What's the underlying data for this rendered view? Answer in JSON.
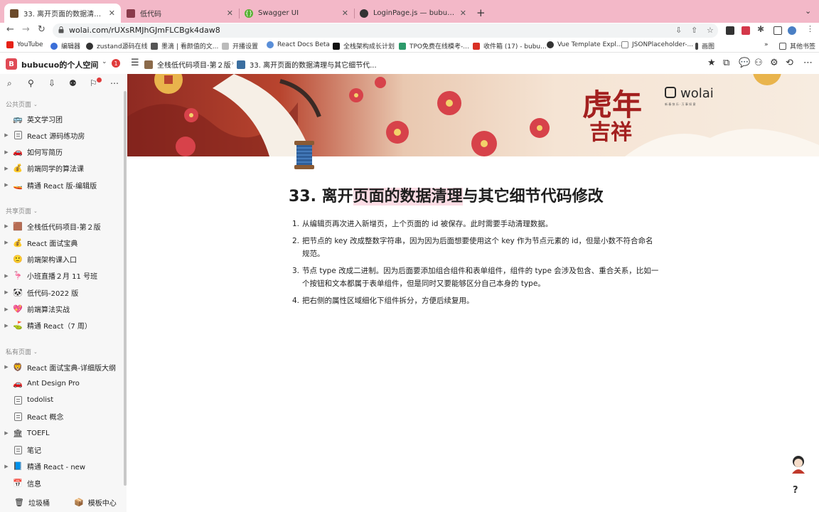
{
  "browser": {
    "tabs": [
      {
        "title": "33. 离开页面的数据清理与其它细节代码修改",
        "active": true
      },
      {
        "title": "低代码",
        "active": false
      },
      {
        "title": "Swagger UI",
        "active": false
      },
      {
        "title": "LoginPage.js — bubucuo/async",
        "active": false
      }
    ],
    "url": "wolai.com/rUXsRMJhGJmFLCBgk4daw8",
    "bookmarks": [
      {
        "label": "YouTube",
        "color": "#e62117"
      },
      {
        "label": "编辑器",
        "color": "#3b6fd8"
      },
      {
        "label": "zustand源码在线",
        "color": "#333333"
      },
      {
        "label": "墨滴 | 看颜值的文...",
        "color": "#555555"
      },
      {
        "label": "开播设置",
        "color": "#aaaaaa"
      },
      {
        "label": "React Docs Beta",
        "color": "#5a8fd8"
      },
      {
        "label": "全栈架构成长计划",
        "color": "#111111"
      },
      {
        "label": "TPO免费在线模考-...",
        "color": "#2c9a6a"
      },
      {
        "label": "收件箱 (17) - bubu...",
        "color": "#d93025"
      },
      {
        "label": "Vue Template Expl...",
        "color": "#333333"
      },
      {
        "label": "JSONPlaceholder-...",
        "color": "#888888"
      },
      {
        "label": "画图",
        "color": "#444444"
      }
    ],
    "bookmarks_other": "其他书签"
  },
  "workspace": {
    "logo_letter": "B",
    "name": "bubucuo的个人空间",
    "badge": "1"
  },
  "breadcrumb": {
    "parent": "全栈低代码项目-第２版",
    "current": "33. 离开页面的数据清理与其它细节代..."
  },
  "sidebar": {
    "sections": {
      "public": "公共页面",
      "shared": "共享页面",
      "private": "私有页面"
    },
    "public_items": [
      {
        "label": "英文学习团",
        "icon": "bus-icon",
        "glyph": "🚌",
        "arrow": false
      },
      {
        "label": "React 源码练功房",
        "icon": "page-icon",
        "glyph": "",
        "arrow": true
      },
      {
        "label": "如何写简历",
        "icon": "car-icon",
        "glyph": "🚗",
        "arrow": true
      },
      {
        "label": "前端同学的算法课",
        "icon": "coin-icon",
        "glyph": "💰",
        "arrow": true
      },
      {
        "label": "精通 React 版-编辑版",
        "icon": "boat-icon",
        "glyph": "🚤",
        "arrow": true
      }
    ],
    "shared_items": [
      {
        "label": "全栈低代码项目-第２版",
        "icon": "box-icon",
        "glyph": "🟫",
        "arrow": true
      },
      {
        "label": "React 面试宝典",
        "icon": "coin-icon",
        "glyph": "💰",
        "arrow": true
      },
      {
        "label": "前端架构课入口",
        "icon": "smile-icon",
        "glyph": "🙂",
        "arrow": false
      },
      {
        "label": "小班直播２月 11 号班",
        "icon": "flamingo-icon",
        "glyph": "🦩",
        "arrow": true
      },
      {
        "label": "低代码-2022 版",
        "icon": "panda-icon",
        "glyph": "🐼",
        "arrow": true
      },
      {
        "label": "前端算法实战",
        "icon": "heart-icon",
        "glyph": "💖",
        "arrow": true
      },
      {
        "label": "精通 React（7 周）",
        "icon": "golf-icon",
        "glyph": "⛳",
        "arrow": true
      }
    ],
    "private_items": [
      {
        "label": "React 面试宝典-详细版大纲",
        "icon": "lion-icon",
        "glyph": "🦁",
        "arrow": true
      },
      {
        "label": "Ant Design Pro",
        "icon": "car-icon",
        "glyph": "🚗",
        "arrow": false
      },
      {
        "label": "todolist",
        "icon": "page-icon",
        "glyph": "",
        "arrow": false
      },
      {
        "label": "React 概念",
        "icon": "page-icon",
        "glyph": "",
        "arrow": false
      },
      {
        "label": "TOEFL",
        "icon": "building-icon",
        "glyph": "🏛",
        "arrow": true
      },
      {
        "label": "笔记",
        "icon": "page-icon",
        "glyph": "",
        "arrow": false
      },
      {
        "label": "精通 React - new",
        "icon": "book-icon",
        "glyph": "📘",
        "arrow": true
      },
      {
        "label": "信息",
        "icon": "calendar-icon",
        "glyph": "📅",
        "arrow": false
      }
    ],
    "trash": "垃圾桶",
    "templates": "模板中心"
  },
  "page": {
    "title_prefix": "33. 离开",
    "title_highlight": "页面的数据清理",
    "title_suffix": "与其它细节代码修改",
    "items": [
      {
        "num": "1.",
        "text": "从编辑页再次进入新增页，上个页面的 id 被保存。此时需要手动清理数据。"
      },
      {
        "num": "2.",
        "text": "把节点的 key 改成整数字符串，因为因为后面想要使用这个 key 作为节点元素的 id，但是小数不符合命名规范。"
      },
      {
        "num": "3.",
        "text": "节点 type 改成二进制。因为后面要添加组合组件和表单组件，组件的 type 会涉及包含、重合关系，比如一个按钮和文本都属于表单组件，但是同时又要能够区分自己本身的 type。"
      },
      {
        "num": "4.",
        "text": "把右侧的属性区域细化下组件拆分，方便后续复用。"
      }
    ]
  },
  "cover": {
    "logo_text": "wolai",
    "logo_sub": "新 春 快 乐 · 万 事 如 意",
    "seal_text": "虎年吉祥"
  },
  "help_label": "?"
}
